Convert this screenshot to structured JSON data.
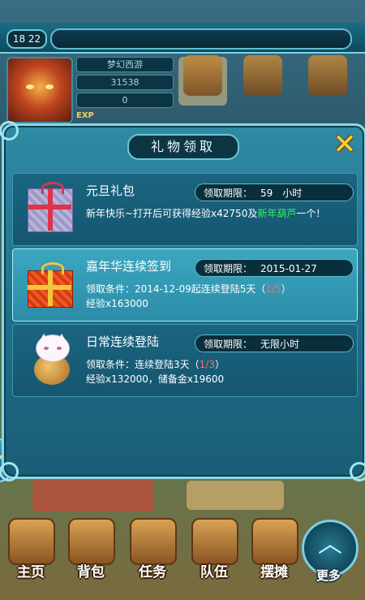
{
  "status": {
    "time": "18 22"
  },
  "player": {
    "name": "梦幻西游",
    "gold": "31538",
    "item_count": "0",
    "exp_label": "EXP"
  },
  "dialog": {
    "title": "礼物领取",
    "close_icon": "close-x-icon",
    "rows": [
      {
        "icon": "gift-box-icon",
        "name": "元旦礼包",
        "deadline_label": "领取期限：",
        "deadline_value": "59　小时",
        "desc_plain": "新年快乐~打开后可获得经验x42750及",
        "desc_green": "新年葫芦",
        "desc_tail": "一个！"
      },
      {
        "icon": "red-gift-icon",
        "name": "嘉年华连续签到",
        "deadline_label": "领取期限：",
        "deadline_value": "2015-01-27",
        "cond_label": "领取条件：2014-12-09起连续登陆5天（",
        "cond_progress": "1/5",
        "cond_close": "）",
        "reward": "经验x163000"
      },
      {
        "icon": "lucky-cat-icon",
        "name": "日常连续登陆",
        "deadline_label": "领取期限：",
        "deadline_value": "无限小时",
        "cond_label": "领取条件：连续登陆3天（",
        "cond_progress": "1/3",
        "cond_close": "）",
        "reward": "经验x132000，储备金x19600"
      }
    ]
  },
  "bottom_nav": {
    "items": [
      {
        "label": "主页",
        "icon": "home-icon"
      },
      {
        "label": "背包",
        "icon": "bag-icon"
      },
      {
        "label": "任务",
        "icon": "quest-scroll-icon"
      },
      {
        "label": "队伍",
        "icon": "team-icon"
      },
      {
        "label": "摆摊",
        "icon": "stall-icon"
      }
    ],
    "more_label": "更多"
  },
  "colors": {
    "dialog_bg": "#1f6c86",
    "highlight_row": "#2c8da8",
    "progress_red": "#ff6a5a",
    "item_green": "#35f25a",
    "close_yellow": "#ffd23a"
  }
}
